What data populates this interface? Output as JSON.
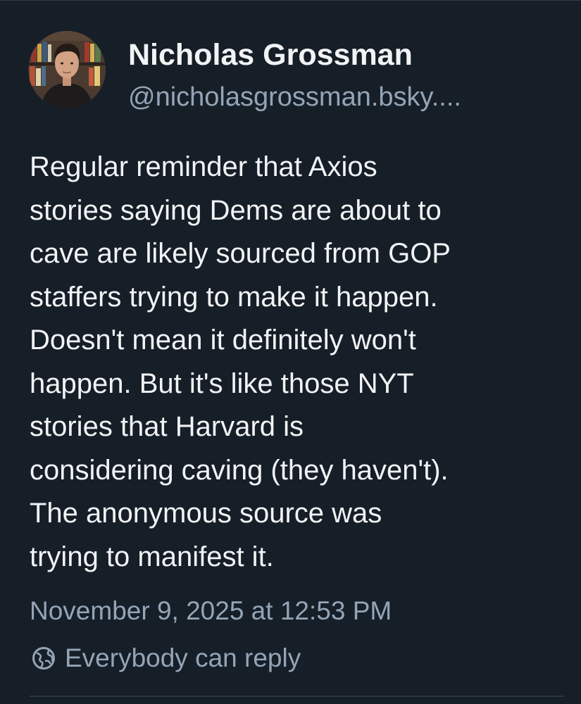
{
  "post": {
    "author": {
      "display_name": "Nicholas Grossman",
      "handle": "@nicholasgrossman.bsky...."
    },
    "text_lines": [
      "Regular reminder that Axios",
      "stories saying Dems are about to",
      "cave are likely sourced from GOP",
      "staffers trying to make it happen.",
      "Doesn't mean it definitely won't",
      "happen. But it's like those NYT",
      "stories that Harvard is",
      "considering caving (they haven't).",
      "The anonymous source was",
      "trying to manifest it."
    ],
    "timestamp": "November 9, 2025 at 12:53 PM",
    "reply_setting": {
      "icon": "globe-icon",
      "label": "Everybody can reply"
    }
  },
  "colors": {
    "background": "#161e27",
    "primary_text": "#f1f3f5",
    "secondary_text": "#93a5b7"
  }
}
